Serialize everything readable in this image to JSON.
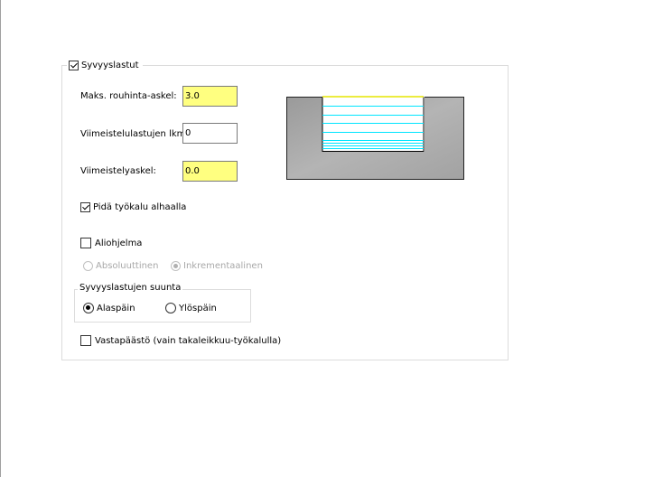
{
  "group": {
    "title": "Syvyyslastut",
    "checked": true
  },
  "fields": {
    "max_rough_step": {
      "label": "Maks. rouhinta-askel:",
      "value": "3.0"
    },
    "finish_count": {
      "label": "Viimeistelulastujen lkm:",
      "value": "0"
    },
    "finish_step": {
      "label": "Viimeistelyaskel:",
      "value": "0.0"
    }
  },
  "keep_tool_down": {
    "label": "Pidä työkalu alhaalla",
    "checked": true
  },
  "subprogram": {
    "label": "Aliohjelma",
    "checked": false,
    "absolute_label": "Absoluuttinen",
    "incremental_label": "Inkrementaalinen",
    "selected": "incremental"
  },
  "direction": {
    "title": "Syvyyslastujen suunta",
    "down_label": "Alaspäin",
    "up_label": "Ylöspäin",
    "selected": "down"
  },
  "back_facing": {
    "label": "Vastapäästö (vain takaleikkuu-työkalulla)",
    "checked": false
  },
  "colors": {
    "highlight_field": "#ffff80",
    "pass_lines": "#00e5ff",
    "top_line": "#e6e600",
    "material": "#a9a9a9"
  }
}
